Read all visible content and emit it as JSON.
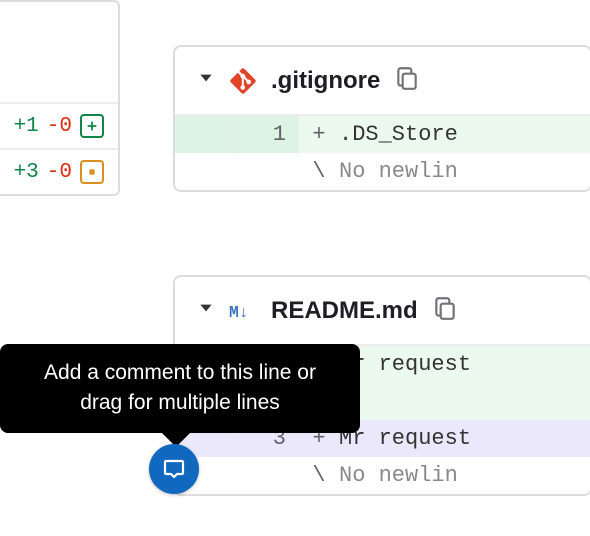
{
  "sidebar": {
    "stats": [
      {
        "additions": "+1",
        "deletions": "-0",
        "change_type": "added"
      },
      {
        "additions": "+3",
        "deletions": "-0",
        "change_type": "modified"
      }
    ]
  },
  "diffs": [
    {
      "file_name": ".gitignore",
      "icon": "git-icon",
      "lines": [
        {
          "old": "",
          "new": "1",
          "sign": "+",
          "content": ".DS_Store",
          "style": "added"
        },
        {
          "old": "",
          "new": "",
          "sign": "\\",
          "content": "No newlin",
          "style": "plain"
        }
      ]
    },
    {
      "file_name": "README.md",
      "icon": "markdown-icon",
      "lines": [
        {
          "old": "",
          "new": "",
          "sign": "+",
          "content": "Mr request",
          "style": "added"
        },
        {
          "old": "",
          "new": "",
          "sign": "+",
          "content": "",
          "style": "added"
        },
        {
          "old": "",
          "new": "3",
          "sign": "+",
          "content": "Mr request",
          "style": "highlight"
        },
        {
          "old": "",
          "new": "",
          "sign": "\\",
          "content": "No newlin",
          "style": "plain"
        }
      ]
    }
  ],
  "tooltip": {
    "text": "Add a comment to this line or drag for multiple lines"
  }
}
